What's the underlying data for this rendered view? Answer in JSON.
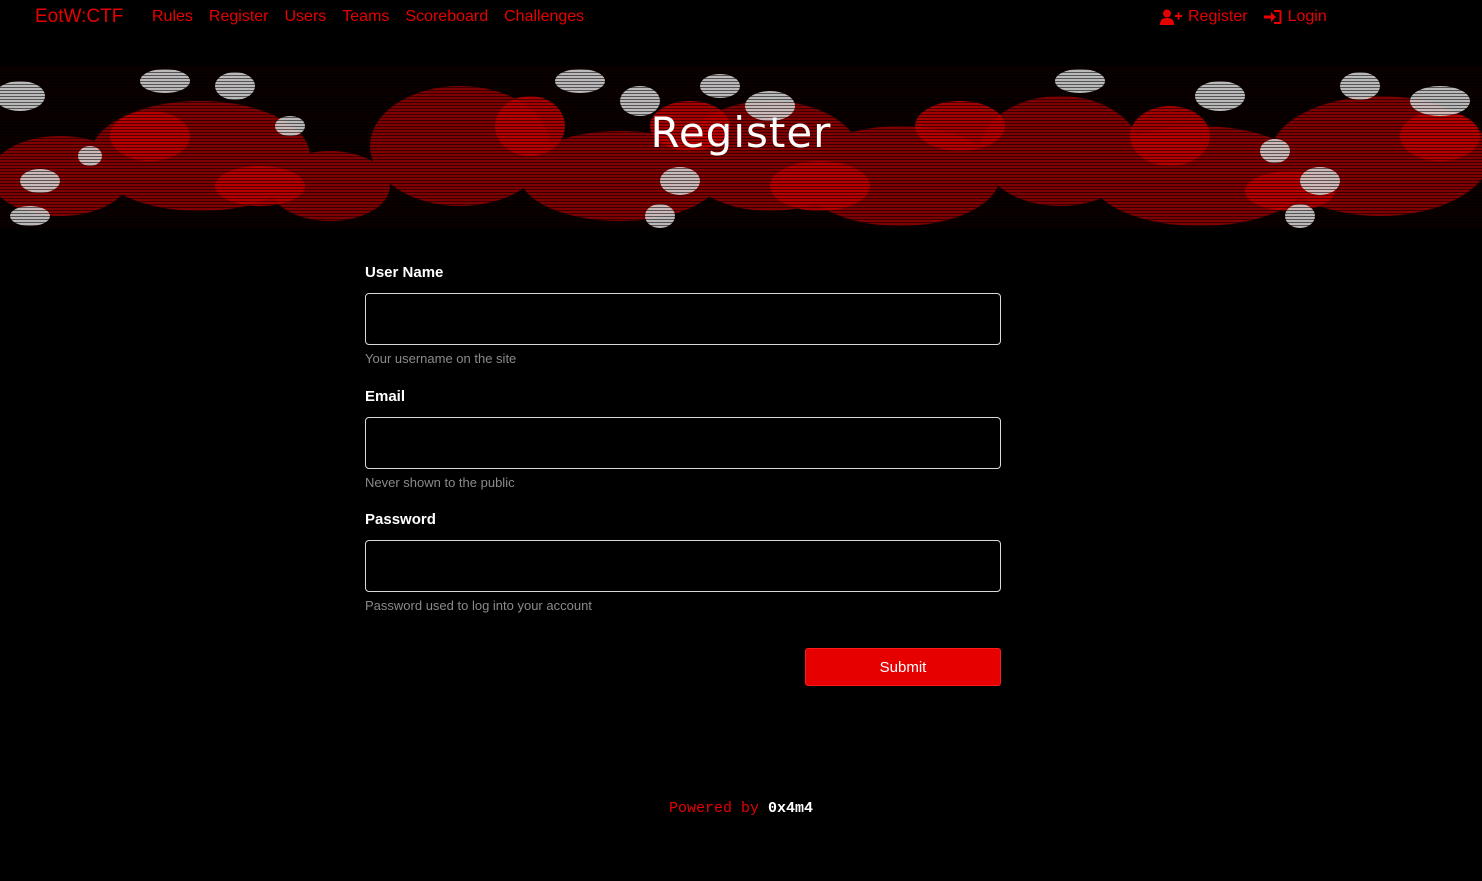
{
  "navbar": {
    "brand": "EotW:CTF",
    "links": [
      "Rules",
      "Register",
      "Users",
      "Teams",
      "Scoreboard",
      "Challenges"
    ],
    "right": {
      "register_label": "Register",
      "register_icon": "user-plus-icon",
      "login_label": "Login",
      "login_icon": "sign-in-icon"
    }
  },
  "hero": {
    "title": "Register"
  },
  "form": {
    "username": {
      "label": "User Name",
      "value": "",
      "help": "Your username on the site"
    },
    "email": {
      "label": "Email",
      "value": "",
      "help": "Never shown to the public"
    },
    "password": {
      "label": "Password",
      "value": "",
      "help": "Password used to log into your account"
    },
    "submit_label": "Submit"
  },
  "footer": {
    "powered_by": "Powered by",
    "author": "0x4m4"
  },
  "colors": {
    "accent": "#e60000",
    "background": "#000000",
    "muted_text": "#8a8a8a"
  }
}
